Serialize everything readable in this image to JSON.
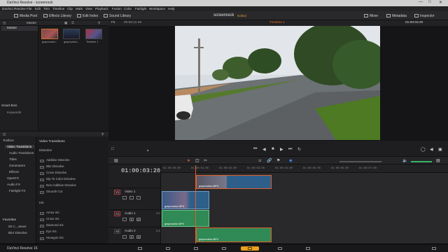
{
  "window": {
    "title": "DaVinci Resolve - screenreck"
  },
  "menu": [
    "DaVinci Resolve",
    "File",
    "Edit",
    "Trim",
    "Timeline",
    "Clip",
    "Mark",
    "View",
    "Playback",
    "Fusion",
    "Color",
    "Fairlight",
    "Workspace",
    "Help"
  ],
  "toolbar": {
    "media_pool": "Media Pool",
    "effects_library": "Effects Library",
    "edit_index": "Edit Index",
    "sound_library": "Sound Library",
    "project_name": "screenreck",
    "edited_status": "Edited",
    "mixer": "Mixer",
    "metadata": "Metadata",
    "inspector": "Inspector"
  },
  "media_pool": {
    "bin_label": "Master",
    "bins": {
      "master": "Master",
      "smart_bins": "Smart Bins",
      "keywords": "Keywords"
    },
    "clips": [
      {
        "name": "grapnoobor..."
      },
      {
        "name": "grapnoobor..."
      },
      {
        "name": "Timeline 1"
      }
    ]
  },
  "viewer": {
    "fit": "Fit",
    "source_tc": "00:00:11:29",
    "timeline_name": "Timeline 1",
    "record_tc": "01:00:03:20"
  },
  "effects": {
    "tree": [
      "Toolbox",
      "Video Transitions",
      "Audio Transitions",
      "Titles",
      "Generators",
      "Effects",
      "OpenFX",
      "Audio FX",
      "Fairlight FX"
    ],
    "header": "Video Transitions",
    "category_dissolve": "Dissolve",
    "dissolve_items": [
      "Additive Dissolve",
      "Blur Dissolve",
      "Cross Dissolve",
      "Dip To Color Dissolve",
      "Non-Additive Dissolve",
      "Smooth Cut"
    ],
    "category_iris": "Iris",
    "iris_items": [
      "Arrow Iris",
      "Cross Iris",
      "Diamond Iris",
      "Eye Iris",
      "Hexagon Iris"
    ],
    "favorites": {
      "title": "Favorites",
      "items": [
        "00 C...Jesus",
        "Blur Dissolve"
      ]
    }
  },
  "timeline": {
    "timecode": "01:00:03:20",
    "ruler": [
      "01:00:00:00",
      "01:00:01:00",
      "01:00:02:00",
      "01:00:03:00",
      "01:00:04:00",
      "01:00:05:00",
      "01:00:06:00",
      "01:00:07:00"
    ],
    "tracks": [
      {
        "tag": "V1",
        "name": "Video 1"
      },
      {
        "tag": "A1",
        "name": "Audio 1",
        "level": "2.0"
      },
      {
        "tag": "A2",
        "name": "Audio 2",
        "level": "2.0"
      }
    ],
    "clip_name": "grapnoobor.MP4"
  },
  "pagebar": {
    "app": "DaVinci Resolve 16"
  },
  "colors": {
    "accent": "#e9a11c",
    "edited": "#d9922e",
    "video_clip": "#2e5f8a",
    "audio_clip": "#2f8a55",
    "playhead": "#e35d2a"
  }
}
